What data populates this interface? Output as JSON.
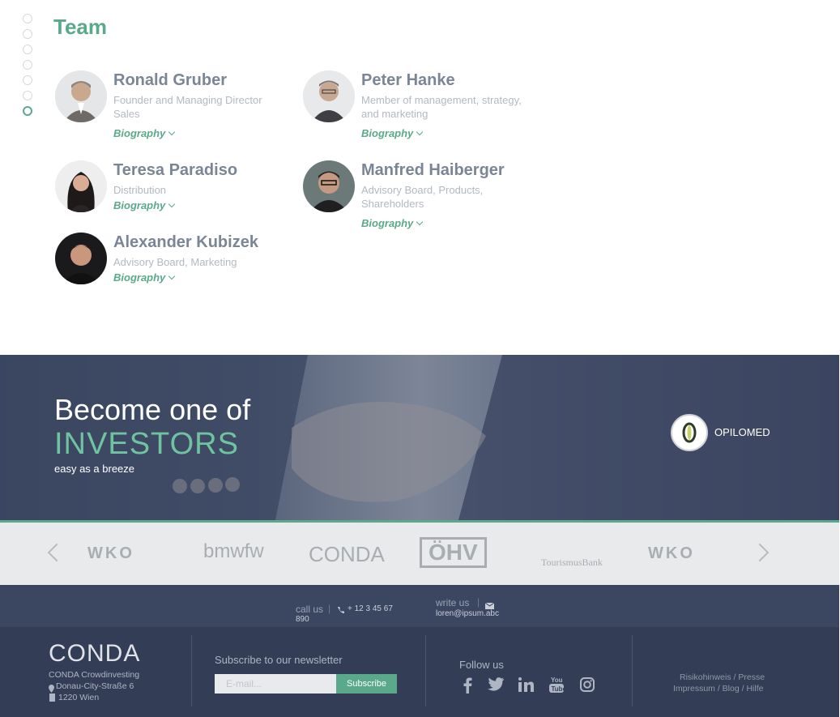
{
  "team": {
    "title": "Team",
    "members": [
      {
        "name": "Ronald Gruber",
        "role": "Founder and Managing Director Sales",
        "bio": "Biography"
      },
      {
        "name": "Peter Hanke",
        "role": "Member of management, strategy, and marketing",
        "bio": "Biography"
      },
      {
        "name": "Teresa Paradiso",
        "role": "Distribution",
        "bio": "Biography"
      },
      {
        "name": "Manfred Haiberger",
        "role": "Advisory Board, Products, Shareholders",
        "bio": "Biography"
      },
      {
        "name": "Alexander Kubizek",
        "role": "Advisory Board, Marketing",
        "bio": "Biography"
      }
    ]
  },
  "hero": {
    "title_line1": "Become one of",
    "title_line2": "INVESTORS",
    "subtitle": "easy as a breeze",
    "badge_label": "OPILOMED"
  },
  "partners": {
    "logos": [
      "WKO",
      "bmwfw",
      "CONDA",
      "ÖHV",
      "TourismusBank",
      "WKO"
    ]
  },
  "contact": {
    "call_label": "call us",
    "phone": "+ 12 3 45 67",
    "phone_cont": "890",
    "write_label": "write us",
    "email": "loren@ipsum.abc"
  },
  "footer": {
    "logo": "CONDA",
    "company": "CONDA Crowdinvesting",
    "street": "Donau-City-Straße 6",
    "city": "1220 Wien",
    "newsletter_label": "Subscribe to our newsletter",
    "email_placeholder": "E-mail...",
    "subscribe_label": "Subscribe",
    "follow_label": "Follow us",
    "links_line1": "Risikohinweis / Presse",
    "links_line2": "Impressum / Blog / Hilfe"
  },
  "colors": {
    "accent": "#5aa98a",
    "footer_bg": "#333d56",
    "contact_bg": "#3b4661"
  }
}
